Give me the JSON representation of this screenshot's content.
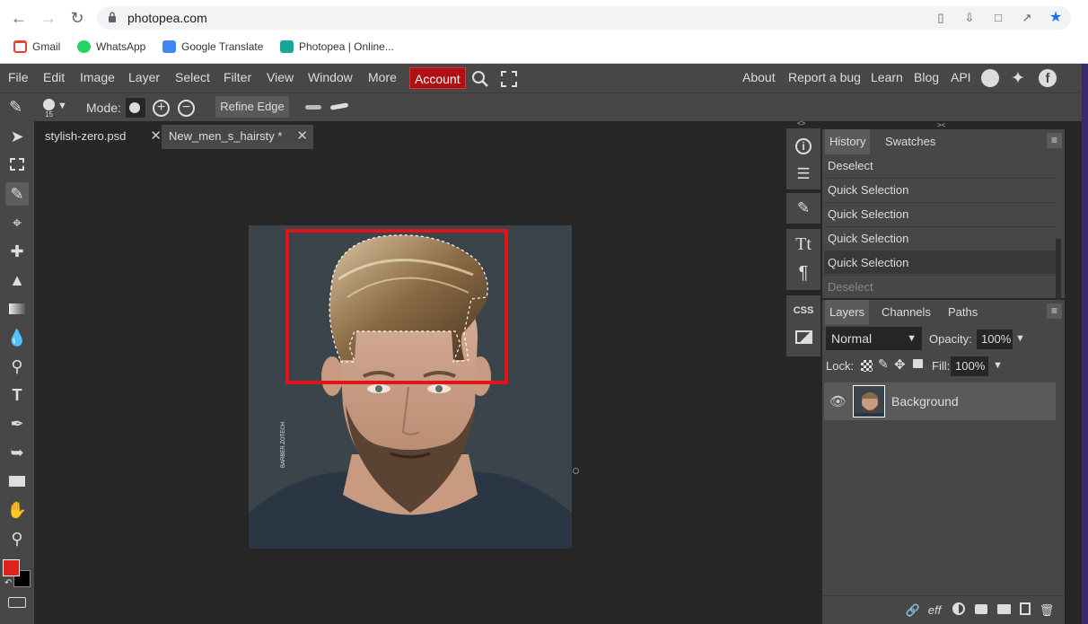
{
  "browser": {
    "url": "photopea.com",
    "bookmarks": [
      "Gmail",
      "WhatsApp",
      "Google Translate",
      "Photopea | Online..."
    ]
  },
  "menu": {
    "items": [
      "File",
      "Edit",
      "Image",
      "Layer",
      "Select",
      "Filter",
      "View",
      "Window",
      "More"
    ],
    "account": "Account",
    "right_items": [
      "About",
      "Report a bug",
      "Learn",
      "Blog",
      "API"
    ]
  },
  "options": {
    "brush_size": "15",
    "mode_label": "Mode:",
    "refine_edge": "Refine Edge"
  },
  "documents": {
    "tabs": [
      {
        "label": "stylish-zero.psd",
        "active": true
      },
      {
        "label": "New_men_s_hairsty *",
        "active": false
      }
    ]
  },
  "canvas": {
    "watermark": "BARBER.ZOTECH"
  },
  "history": {
    "tabs": [
      "History",
      "Swatches"
    ],
    "items": [
      "Deselect",
      "Quick Selection",
      "Quick Selection",
      "Quick Selection",
      "Quick Selection",
      "Deselect"
    ]
  },
  "layers": {
    "tabs": [
      "Layers",
      "Channels",
      "Paths"
    ],
    "blend_mode": "Normal",
    "opacity_label": "Opacity:",
    "opacity_value": "100%",
    "lock_label": "Lock:",
    "fill_label": "Fill:",
    "fill_value": "100%",
    "layer_name": "Background",
    "footer_eff": "eff"
  },
  "colors": {
    "foreground": "#e0201c",
    "background": "#000000",
    "account_bg": "#b01014",
    "selection_rect": "#e0151c"
  }
}
